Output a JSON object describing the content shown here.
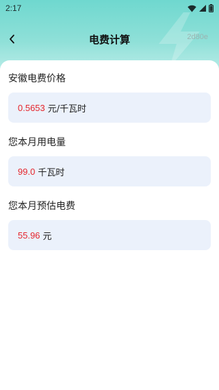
{
  "status_bar": {
    "time": "2:17",
    "icons": [
      "wifi-icon",
      "signal-icon",
      "battery-icon"
    ]
  },
  "nav": {
    "title": "电费计算",
    "tag": "2d80e",
    "back_icon": "chevron-left-icon"
  },
  "sections": [
    {
      "label": "安徽电费价格",
      "value": "0.5653",
      "unit": "元/千瓦时"
    },
    {
      "label": "您本月用电量",
      "value": "99.0",
      "unit": "千瓦时"
    },
    {
      "label": "您本月预估电费",
      "value": "55.96",
      "unit": "元"
    }
  ],
  "colors": {
    "header_gradient_top": "#6fd8cf",
    "value_red": "#e5262d",
    "box_bg": "#ebf1fb"
  }
}
